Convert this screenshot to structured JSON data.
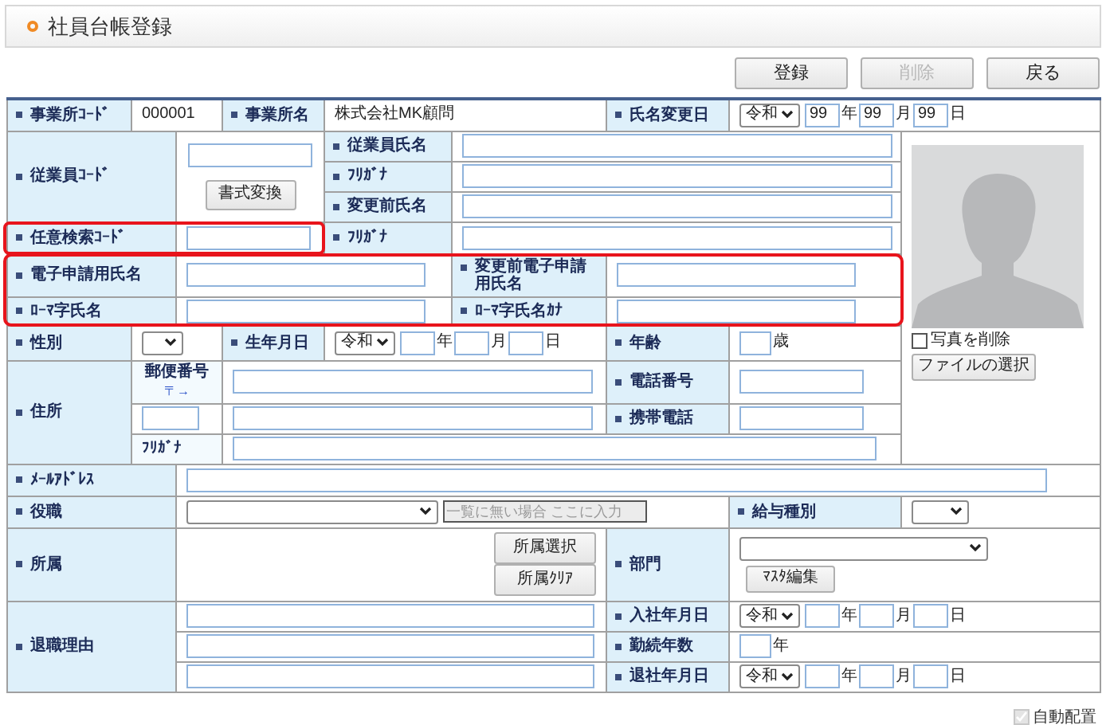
{
  "title": "社員台帳登録",
  "buttons": [
    {
      "label": "登録",
      "disabled": false
    },
    {
      "label": "削除",
      "disabled": true
    },
    {
      "label": "戻る",
      "disabled": false
    }
  ],
  "form": {
    "office_code": {
      "label": "事業所ｺｰﾄﾞ",
      "value": "000001"
    },
    "office_name": {
      "label": "事業所名",
      "value": "株式会社MK顧問"
    },
    "name_change_date": {
      "label": "氏名変更日",
      "era": "令和",
      "year": "99",
      "year_unit": "年",
      "month": "99",
      "month_unit": "月",
      "day": "99",
      "day_unit": "日"
    },
    "employee_code": {
      "label": "従業員ｺｰﾄﾞ",
      "button": "書式変換"
    },
    "employee_name": {
      "label": "従業員氏名"
    },
    "furigana": {
      "label": "ﾌﾘｶﾞﾅ"
    },
    "former_name": {
      "label": "変更前氏名"
    },
    "search_code": {
      "label": "任意検索ｺｰﾄﾞ",
      "highlighted": true
    },
    "former_furigana": {
      "label": "ﾌﾘｶﾞﾅ"
    },
    "e_name": {
      "label": "電子申請用氏名",
      "highlighted": true
    },
    "former_e_name": {
      "label": "変更前電子申請用氏名"
    },
    "romaji": {
      "label": "ﾛｰﾏ字氏名"
    },
    "romaji_kana": {
      "label": "ﾛｰﾏ字氏名ｶﾅ"
    },
    "gender": {
      "label": "性別"
    },
    "birth": {
      "label": "生年月日",
      "era": "令和",
      "year_unit": "年",
      "month_unit": "月",
      "day_unit": "日"
    },
    "age": {
      "label": "年齢",
      "unit": "歳"
    },
    "address": {
      "label": "住所",
      "postal_label": "郵便番号",
      "postal_link": "〒→",
      "furigana_label": "ﾌﾘｶﾞﾅ"
    },
    "phone": {
      "label": "電話番号"
    },
    "mobile": {
      "label": "携帯電話"
    },
    "email": {
      "label": "ﾒｰﾙｱﾄﾞﾚｽ"
    },
    "position": {
      "label": "役職",
      "placeholder": "一覧に無い場合 ここに入力"
    },
    "pay_type": {
      "label": "給与種別"
    },
    "affiliation": {
      "label": "所属",
      "buttons": [
        "所属選択",
        "所属ｸﾘｱ"
      ]
    },
    "department": {
      "label": "部門",
      "button": "ﾏｽﾀ編集"
    },
    "retire_reason": {
      "label": "退職理由"
    },
    "hire_date": {
      "label": "入社年月日",
      "era": "令和",
      "year_unit": "年",
      "month_unit": "月",
      "day_unit": "日"
    },
    "years": {
      "label": "勤続年数",
      "unit": "年"
    },
    "retire_date": {
      "label": "退社年月日",
      "era": "令和",
      "year_unit": "年",
      "month_unit": "月",
      "day_unit": "日"
    }
  },
  "photo": {
    "delete_label": "写真を削除",
    "delete_checked": false,
    "file_button": "ファイルの選択"
  },
  "auto_layout": {
    "label": "自動配置",
    "checked": true,
    "disabled": true
  }
}
